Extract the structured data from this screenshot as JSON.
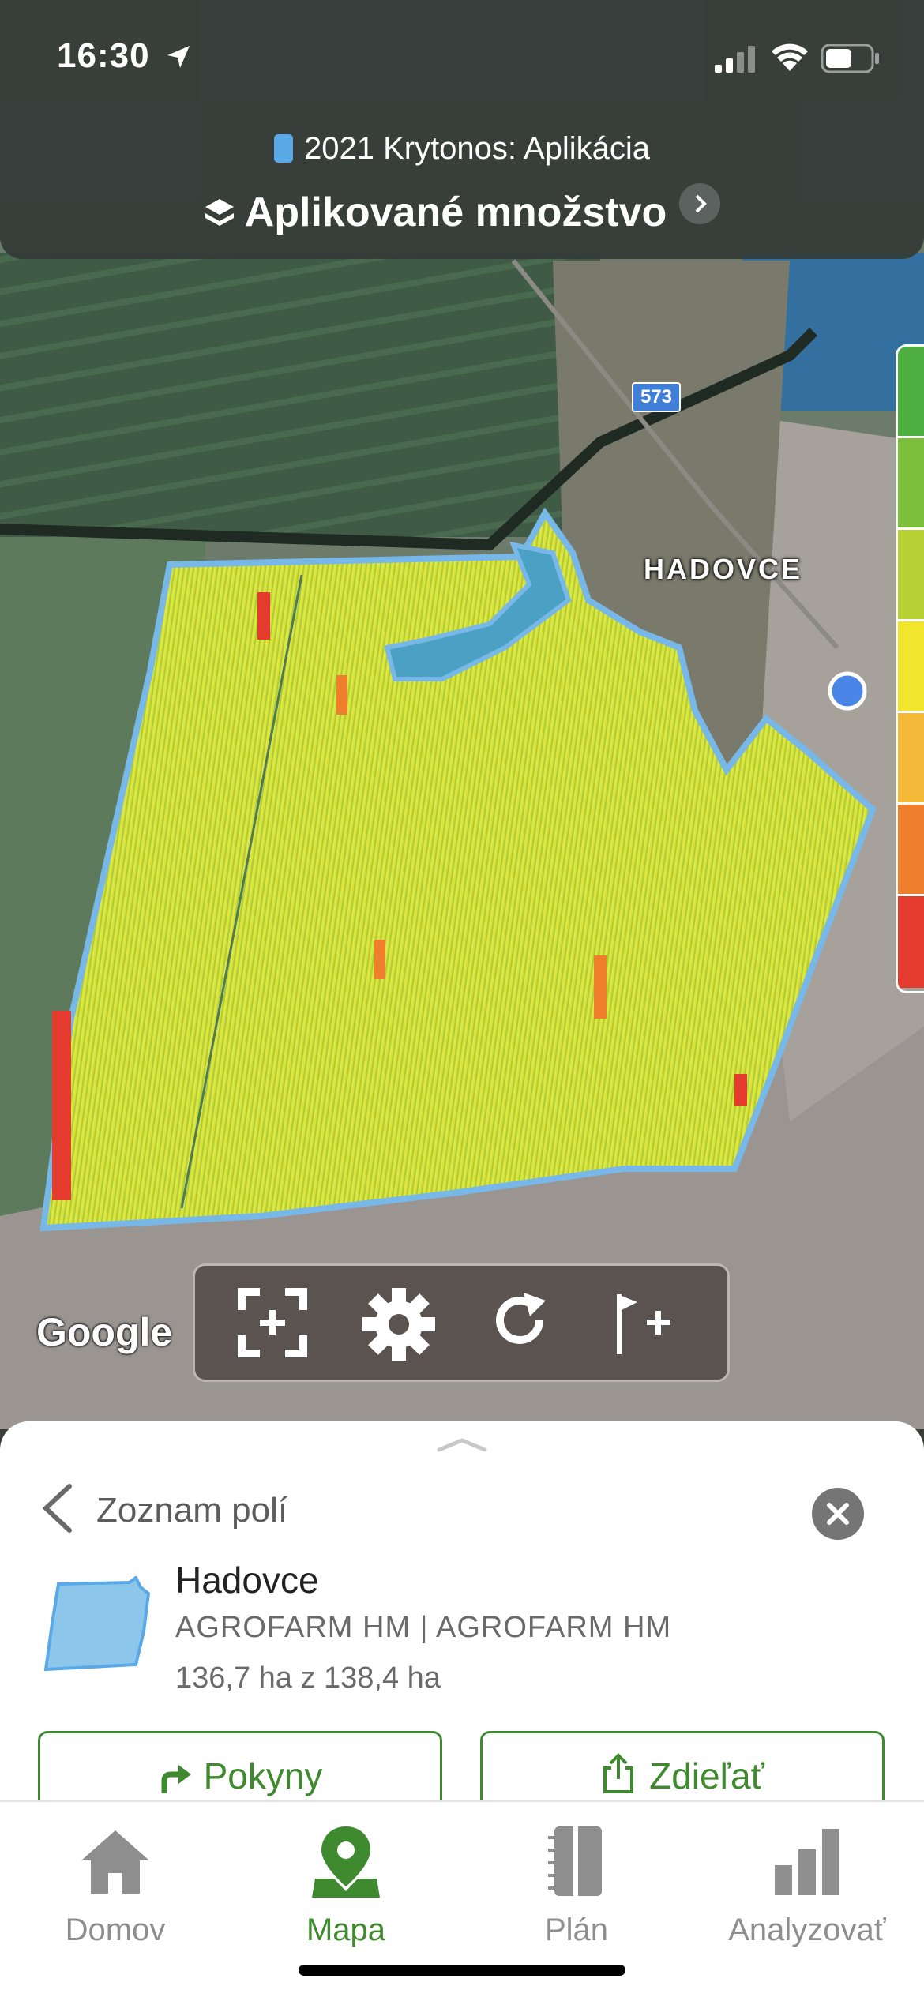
{
  "status_bar": {
    "time": "16:30"
  },
  "header": {
    "subtitle": "2021 Krytonos: Aplikácia",
    "layer_title": "Aplikované množstvo",
    "layer_color": "#5aa9e6"
  },
  "map": {
    "road_number": "573",
    "town_label": "HADOVCE",
    "provider_logo": "Google",
    "legend_colors": [
      "#4caf3f",
      "#7cbf3a",
      "#b8d235",
      "#f2e52e",
      "#f5b93a",
      "#ef7f2d",
      "#e53a2e"
    ],
    "tools": [
      {
        "name": "fit-bounds-icon"
      },
      {
        "name": "settings-gear-icon"
      },
      {
        "name": "refresh-icon"
      },
      {
        "name": "add-flag-icon"
      }
    ]
  },
  "sheet": {
    "back_label": "Zoznam polí",
    "field_name": "Hadovce",
    "farm": "AGROFARM HM | AGROFARM HM",
    "area": "136,7 ha z 138,4 ha",
    "buttons": {
      "directions": "Pokyny",
      "share": "Zdieľať"
    },
    "accent": "#3f8a2f"
  },
  "tabs": [
    {
      "label": "Domov",
      "icon": "home-icon",
      "active": false
    },
    {
      "label": "Mapa",
      "icon": "map-pin-icon",
      "active": true
    },
    {
      "label": "Plán",
      "icon": "notebook-icon",
      "active": false
    },
    {
      "label": "Analyzovať",
      "icon": "bar-chart-icon",
      "active": false
    }
  ]
}
